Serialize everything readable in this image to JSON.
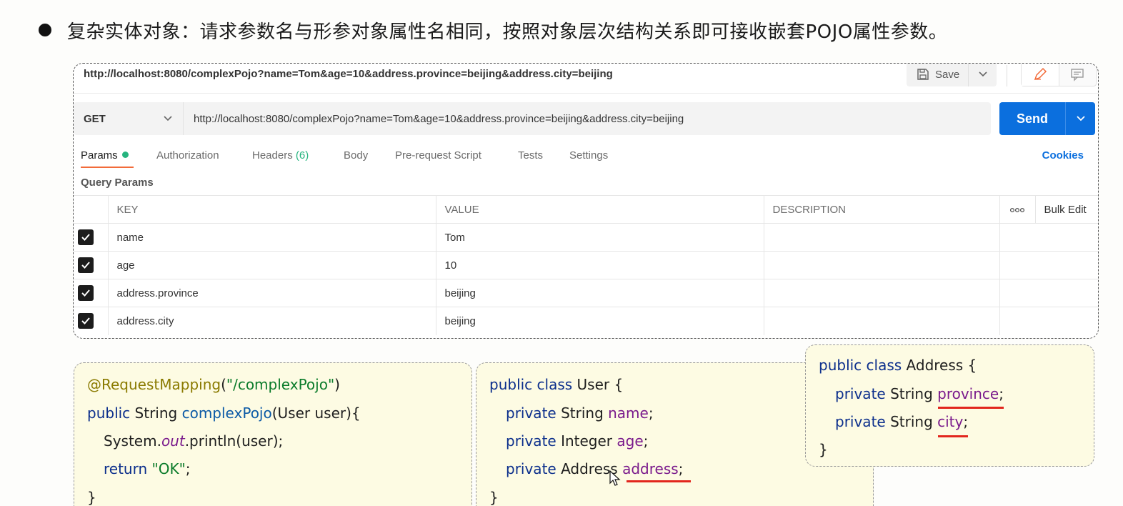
{
  "heading": {
    "text": "复杂实体对象：请求参数名与形参对象属性名相同，按照对象层次结构关系即可接收嵌套POJO属性参数。"
  },
  "postman": {
    "title_url": "http://localhost:8080/complexPojo?name=Tom&age=10&address.province=beijing&address.city=beijing",
    "save_label": "Save",
    "method": "GET",
    "request_url": "http://localhost:8080/complexPojo?name=Tom&age=10&address.province=beijing&address.city=beijing",
    "send_label": "Send",
    "tabs": [
      {
        "label": "Params"
      },
      {
        "label": "Authorization"
      },
      {
        "label": "Headers",
        "count": "(6)"
      },
      {
        "label": "Body"
      },
      {
        "label": "Pre-request Script"
      },
      {
        "label": "Tests"
      },
      {
        "label": "Settings"
      }
    ],
    "cookies_label": "Cookies",
    "query_params_title": "Query Params",
    "columns": {
      "key": "KEY",
      "value": "VALUE",
      "description": "DESCRIPTION",
      "more": "ooo",
      "bulk_edit": "Bulk Edit"
    },
    "rows": [
      {
        "key": "name",
        "value": "Tom",
        "description": ""
      },
      {
        "key": "age",
        "value": "10",
        "description": ""
      },
      {
        "key": "address.province",
        "value": "beijing",
        "description": ""
      },
      {
        "key": "address.city",
        "value": "beijing",
        "description": ""
      }
    ]
  },
  "code_controller": {
    "annotation": "@RequestMapping",
    "path_string": "\"/complexPojo\"",
    "kw_public": "public",
    "ret_type": "String",
    "method_name": "complexPojo",
    "params": "(User user){",
    "sys": "System.",
    "out": "out",
    "println": ".println(user);",
    "kw_return": "return",
    "ok_string": "\"OK\"",
    "semicolon": ";",
    "close": "}"
  },
  "code_user": {
    "kw_public_class": "public class",
    "class_name": "User {",
    "kw_private": "private",
    "fields": [
      {
        "type": "String",
        "name": "name"
      },
      {
        "type": "Integer",
        "name": "age"
      },
      {
        "type": "Address",
        "name": "address"
      }
    ],
    "semicolon": ";",
    "close": "}"
  },
  "code_address": {
    "kw_public_class": "public class",
    "class_name": "Address {",
    "kw_private": "private",
    "fields": [
      {
        "type": "String",
        "name": "province"
      },
      {
        "type": "String",
        "name": "city"
      }
    ],
    "semicolon": ";",
    "close": "}"
  },
  "colors": {
    "send_blue": "#0b6fde",
    "active_tab_underline": "#f26b3a",
    "green_dot": "#26b47f",
    "code_bg": "#fdfbe3",
    "underline_red": "#e2261d"
  }
}
